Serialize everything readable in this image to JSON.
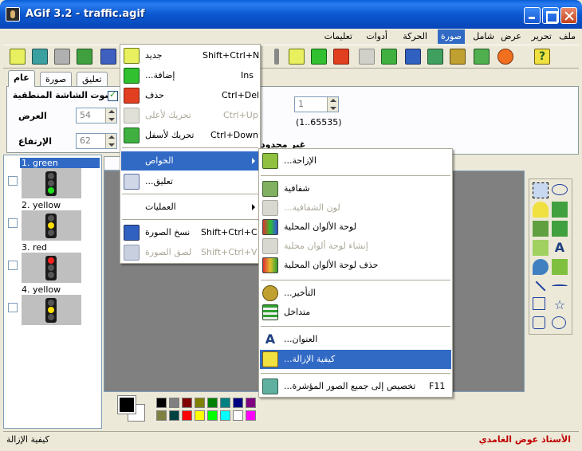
{
  "window": {
    "title": "AGif 3.2 - traffic.agif"
  },
  "menubar": {
    "items": [
      {
        "label": "ملف"
      },
      {
        "label": "تحرير"
      },
      {
        "label": "عرض"
      },
      {
        "label": "شامل"
      },
      {
        "label": "صورة",
        "active": true
      },
      {
        "label": "الحركة"
      },
      {
        "label": "أدوات"
      },
      {
        "label": "تعليمات"
      }
    ]
  },
  "panel": {
    "tabs": [
      "عام",
      "صورة",
      "تعليق"
    ],
    "screen_label": "الشاشة المنطقية",
    "sound_label": "صوت",
    "width_label": "العرض",
    "width_value": "54",
    "height_label": "الإرتفاع",
    "height_value": "62"
  },
  "props_right": {
    "loop_value": "1",
    "range_text": "(1..65535)",
    "unlimited_text": "غير محدود"
  },
  "frames": [
    {
      "label": "1. green",
      "light": "green",
      "selected": true
    },
    {
      "label": "2. yellow",
      "light": "yellow"
    },
    {
      "label": "3. red",
      "light": "red"
    },
    {
      "label": "4. yellow",
      "light": "yellow"
    }
  ],
  "image_menu": {
    "items": [
      {
        "label": "جديد",
        "shortcut": "Shift+Ctrl+N",
        "icon": "new-frame-icon"
      },
      {
        "label": "إضافة...",
        "shortcut": "Ins",
        "icon": "add-icon"
      },
      {
        "label": "حذف",
        "shortcut": "Ctrl+Del",
        "icon": "delete-icon"
      },
      {
        "label": "تحريك لأعلى",
        "shortcut": "Ctrl+Up",
        "icon": "move-up-icon",
        "disabled": true
      },
      {
        "label": "تحريك لأسفل",
        "shortcut": "Ctrl+Down",
        "icon": "move-down-icon"
      },
      {
        "label": "الخواص",
        "submenu": true,
        "highlighted": true
      },
      {
        "label": "تعليق...",
        "icon": "comment-icon"
      },
      {
        "label": "العمليات",
        "submenu": true
      },
      {
        "label": "نسخ الصورة",
        "shortcut": "Shift+Ctrl+C",
        "icon": "copy-image-icon"
      },
      {
        "label": "لصق الصورة",
        "shortcut": "Shift+Ctrl+V",
        "icon": "paste-image-icon",
        "disabled": true
      }
    ]
  },
  "properties_submenu": {
    "items": [
      {
        "label": "الإزاحة...",
        "icon": "offset-icon"
      },
      {
        "label": "شفافية",
        "icon": "transparency-icon"
      },
      {
        "label": "لون الشفافية...",
        "icon": "transparent-color-icon",
        "disabled": true
      },
      {
        "label": "لوحة الألوان المحلية",
        "icon": "local-palette-icon"
      },
      {
        "label": "إنشاء لوحة ألوان محلية",
        "icon": "create-palette-icon",
        "disabled": true
      },
      {
        "label": "حذف لوحة الألوان المحلية",
        "icon": "remove-palette-icon"
      },
      {
        "label": "التأخير...",
        "icon": "delay-icon"
      },
      {
        "label": "متداخل",
        "icon": "interlaced-icon"
      },
      {
        "label": "العنوان...",
        "icon": "title-icon"
      },
      {
        "label": "كيفية الإزالة...",
        "icon": "disposal-icon",
        "highlighted": true
      },
      {
        "label": "تخصيص إلى جميع الصور المؤشرة...",
        "shortcut": "F11",
        "icon": "assign-all-icon"
      }
    ]
  },
  "palette": [
    "#000000",
    "#808080",
    "#800000",
    "#808000",
    "#008000",
    "#008080",
    "#000080",
    "#800080",
    "#808040",
    "#004040",
    "#ff0000",
    "#ffff00",
    "#00ff00",
    "#00ffff",
    "#ffffff",
    "#ff00ff"
  ],
  "status": {
    "left": "كيفية الإزالة",
    "right": "الأستاذ عوض الغامدي"
  }
}
